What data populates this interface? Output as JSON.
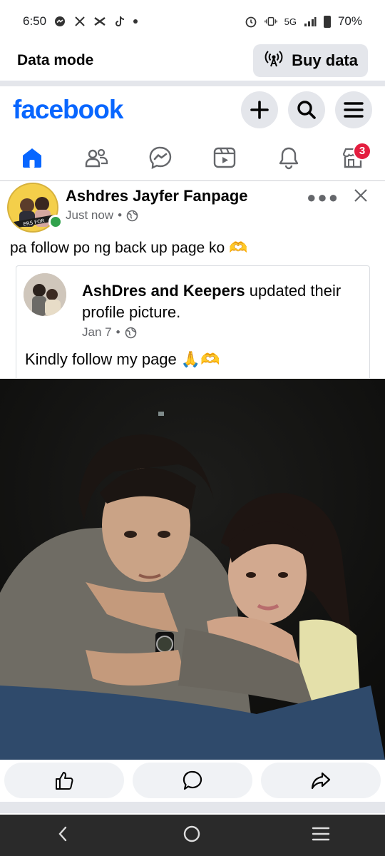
{
  "status_bar": {
    "time": "6:50",
    "network": "5G",
    "battery": "70%"
  },
  "data_mode": {
    "label": "Data mode",
    "buy_button": "Buy data"
  },
  "header": {
    "logo": "facebook"
  },
  "nav": {
    "notification_badge": "3"
  },
  "post": {
    "page_name": "Ashdres Jayfer Fanpage",
    "time": "Just now",
    "text": "pa follow po ng back up page ko 🫶",
    "shared": {
      "author": "AshDres and  Keepers",
      "action": " updated their profile picture.",
      "date": "Jan 7",
      "text": "Kindly follow my page 🙏🫶"
    }
  },
  "colors": {
    "brand": "#0866ff",
    "badge": "#e41e3f",
    "online": "#31a24c"
  }
}
